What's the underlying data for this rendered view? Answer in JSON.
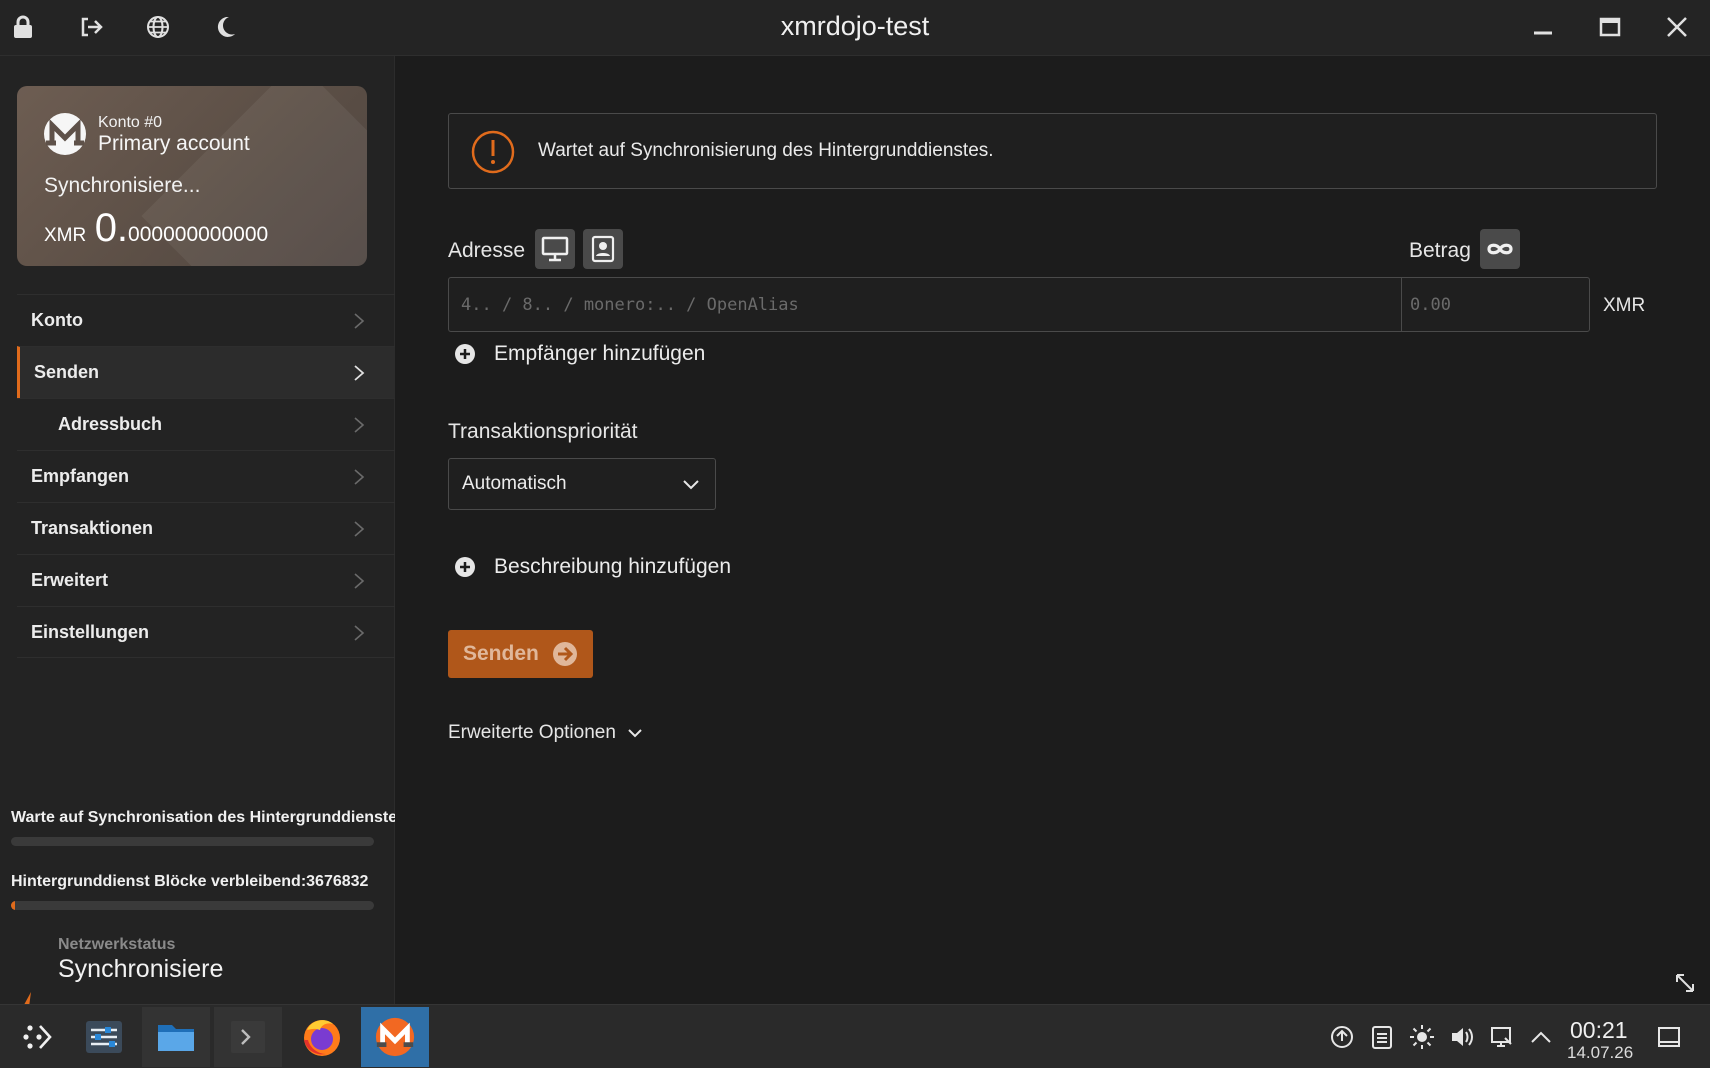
{
  "window": {
    "title": "xmrdojo-test"
  },
  "account_card": {
    "account_number": "Konto #0",
    "account_name": "Primary account",
    "sync_status": "Synchronisiere...",
    "currency": "XMR",
    "balance_int": "0.",
    "balance_frac": "000000000000"
  },
  "sidebar": {
    "items": [
      {
        "label": "Konto"
      },
      {
        "label": "Senden"
      },
      {
        "label": "Adressbuch"
      },
      {
        "label": "Empfangen"
      },
      {
        "label": "Transaktionen"
      },
      {
        "label": "Erweitert"
      },
      {
        "label": "Einstellungen"
      }
    ],
    "active": "Senden"
  },
  "status": {
    "daemon_sync_text": "Warte auf Synchronisation des Hintergrunddienstes",
    "daemon_sync_progress": 0,
    "blocks_text": "Hintergrunddienst Blöcke verbleibend:3676832",
    "blocks_progress": 0.01,
    "network_label": "Netzwerkstatus",
    "network_value": "Synchronisiere"
  },
  "main": {
    "alert_text": "Wartet auf Synchronisierung des Hintergrunddienstes.",
    "address_label": "Adresse",
    "amount_label": "Betrag",
    "address_placeholder": "4.. / 8.. / monero:.. / OpenAlias",
    "amount_placeholder": "0.00",
    "currency": "XMR",
    "add_recipient": "Empfänger hinzufügen",
    "priority_label": "Transaktionspriorität",
    "priority_value": "Automatisch",
    "add_description": "Beschreibung hinzufügen",
    "send_label": "Senden",
    "advanced_options": "Erweiterte Optionen"
  },
  "taskbar": {
    "time": "00:21",
    "date": "14.07.26"
  },
  "colors": {
    "accent": "#e06b1c",
    "send_button": "#b0571a",
    "active_task": "#2f6fa7"
  },
  "icons": [
    "lock-icon",
    "logout-icon",
    "globe-icon",
    "moon-icon",
    "minimize-icon",
    "maximize-icon",
    "close-icon",
    "monero-logo-icon",
    "chevron-right-icon",
    "monitor-icon",
    "address-book-icon",
    "infinity-icon",
    "plus-circle-icon",
    "chevron-down-icon",
    "arrow-right-circle-icon",
    "exclamation-circle-icon",
    "lightning-icon",
    "resize-icon"
  ]
}
